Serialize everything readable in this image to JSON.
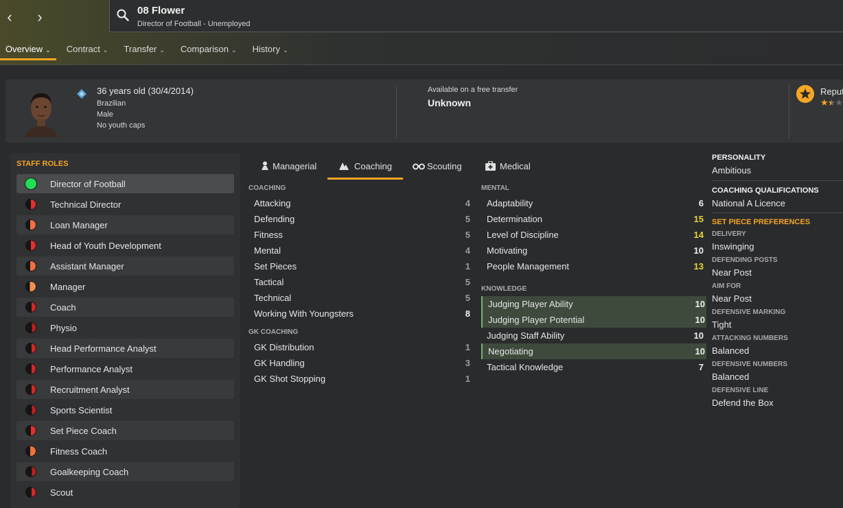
{
  "header": {
    "title": "08 Flower",
    "subtitle": "Director of Football - Unemployed"
  },
  "tabs": [
    {
      "label": "Overview"
    },
    {
      "label": "Contract"
    },
    {
      "label": "Transfer"
    },
    {
      "label": "Comparison"
    },
    {
      "label": "History"
    }
  ],
  "bio": {
    "age": "36 years old (30/4/2014)",
    "nationality": "Brazilian",
    "gender": "Male",
    "caps": "No youth caps"
  },
  "transfer": {
    "label": "Available on a free transfer",
    "value": "Unknown"
  },
  "reputation": {
    "label": "Reputation",
    "stars": 1.5
  },
  "roles": {
    "header": "STAFF ROLES",
    "items": [
      {
        "label": "Director of Football",
        "color": "#22dd55",
        "level": 1.0
      },
      {
        "label": "Technical Director",
        "color": "#e03030",
        "level": 0.5
      },
      {
        "label": "Loan Manager",
        "color": "#f07040",
        "level": 0.55
      },
      {
        "label": "Head of Youth Development",
        "color": "#e03030",
        "level": 0.5
      },
      {
        "label": "Assistant Manager",
        "color": "#f07040",
        "level": 0.55
      },
      {
        "label": "Manager",
        "color": "#f09050",
        "level": 0.6
      },
      {
        "label": "Coach",
        "color": "#d02828",
        "level": 0.45
      },
      {
        "label": "Physio",
        "color": "#c02020",
        "level": 0.4
      },
      {
        "label": "Head Performance Analyst",
        "color": "#d02828",
        "level": 0.45
      },
      {
        "label": "Performance Analyst",
        "color": "#d02828",
        "level": 0.45
      },
      {
        "label": "Recruitment Analyst",
        "color": "#d02828",
        "level": 0.45
      },
      {
        "label": "Sports Scientist",
        "color": "#c02020",
        "level": 0.4
      },
      {
        "label": "Set Piece Coach",
        "color": "#e03030",
        "level": 0.5
      },
      {
        "label": "Fitness Coach",
        "color": "#f07040",
        "level": 0.55
      },
      {
        "label": "Goalkeeping Coach",
        "color": "#c02020",
        "level": 0.4
      },
      {
        "label": "Scout",
        "color": "#d02828",
        "level": 0.45
      }
    ]
  },
  "attr_tabs": [
    {
      "label": "Managerial",
      "icon": "managerial-icon"
    },
    {
      "label": "Coaching",
      "icon": "coaching-icon"
    },
    {
      "label": "Scouting",
      "icon": "binoculars-icon"
    },
    {
      "label": "Medical",
      "icon": "medical-kit-icon"
    }
  ],
  "coaching": {
    "header": "COACHING",
    "items": [
      {
        "name": "Attacking",
        "value": "4"
      },
      {
        "name": "Defending",
        "value": "5"
      },
      {
        "name": "Fitness",
        "value": "5"
      },
      {
        "name": "Mental",
        "value": "4"
      },
      {
        "name": "Set Pieces",
        "value": "1"
      },
      {
        "name": "Tactical",
        "value": "5"
      },
      {
        "name": "Technical",
        "value": "5"
      },
      {
        "name": "Working With Youngsters",
        "value": "8"
      }
    ]
  },
  "gk": {
    "header": "GK COACHING",
    "items": [
      {
        "name": "GK Distribution",
        "value": "1"
      },
      {
        "name": "GK Handling",
        "value": "3"
      },
      {
        "name": "GK Shot Stopping",
        "value": "1"
      }
    ]
  },
  "mental": {
    "header": "MENTAL",
    "items": [
      {
        "name": "Adaptability",
        "value": "6"
      },
      {
        "name": "Determination",
        "value": "15"
      },
      {
        "name": "Level of Discipline",
        "value": "14"
      },
      {
        "name": "Motivating",
        "value": "10"
      },
      {
        "name": "People Management",
        "value": "13"
      }
    ]
  },
  "knowledge": {
    "header": "KNOWLEDGE",
    "items": [
      {
        "name": "Judging Player Ability",
        "value": "10"
      },
      {
        "name": "Judging Player Potential",
        "value": "10"
      },
      {
        "name": "Judging Staff Ability",
        "value": "10"
      },
      {
        "name": "Negotiating",
        "value": "10"
      },
      {
        "name": "Tactical Knowledge",
        "value": "7"
      }
    ]
  },
  "side": {
    "personality_h": "PERSONALITY",
    "personality": "Ambitious",
    "qual_h": "COACHING QUALIFICATIONS",
    "qual": "National A Licence",
    "setpiece_h": "SET PIECE PREFERENCES",
    "delivery_h": "DELIVERY",
    "delivery": "Inswinging",
    "defposts_h": "DEFENDING POSTS",
    "defposts": "Near Post",
    "aimfor_h": "AIM FOR",
    "aimfor": "Near Post",
    "defmark_h": "DEFENSIVE MARKING",
    "defmark": "Tight",
    "attnum_h": "ATTACKING NUMBERS",
    "attnum": "Balanced",
    "defnum_h": "DEFENSIVE NUMBERS",
    "defnum": "Balanced",
    "defline_h": "DEFENSIVE LINE",
    "defline": "Defend the Box"
  }
}
